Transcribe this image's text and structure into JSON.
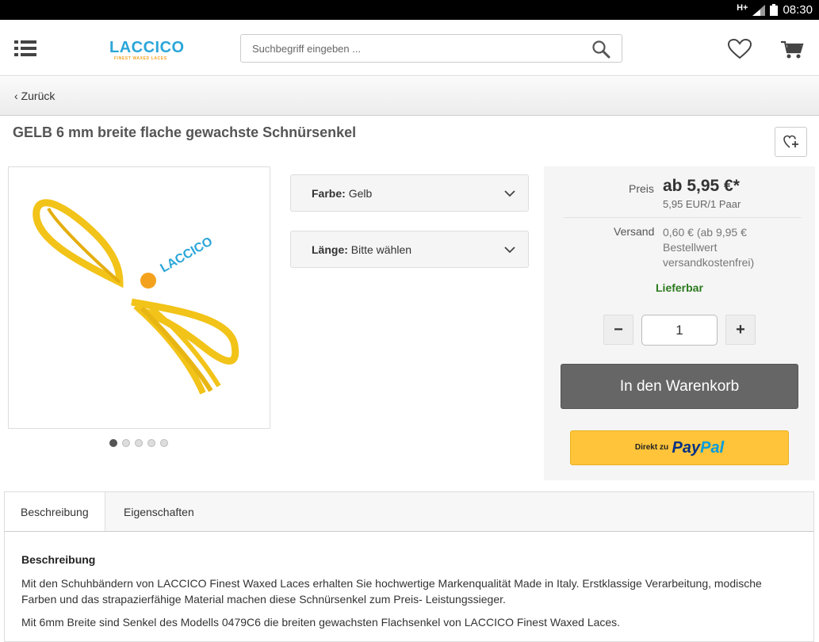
{
  "status_bar": {
    "network": "H+",
    "time": "08:30"
  },
  "header": {
    "logo": {
      "brand": "LACCICO",
      "tagline": "FINEST WAXED LACES"
    },
    "search": {
      "placeholder": "Suchbegriff eingeben ..."
    },
    "icons": [
      "menu-icon",
      "search-icon",
      "heart-icon",
      "cart-icon"
    ]
  },
  "nav": {
    "back_label": "Zurück"
  },
  "product": {
    "title": "GELB 6 mm breite flache gewachste Schnürsenkel",
    "image_dots": 5,
    "active_dot": 1,
    "options": [
      {
        "label": "Farbe:",
        "value": "Gelb"
      },
      {
        "label": "Länge:",
        "value": "Bitte wählen"
      }
    ]
  },
  "buybox": {
    "price_label": "Preis",
    "price_value": "ab 5,95 €*",
    "price_unit": "5,95 EUR/1 Paar",
    "shipping_label": "Versand",
    "shipping_value": "0,60 € (ab 9,95 € Bestellwert versandkostenfrei)",
    "availability": "Lieferbar",
    "quantity": "1",
    "minus": "−",
    "plus": "+",
    "cart_button": "In den Warenkorb",
    "paypal_prefix": "Direkt zu",
    "paypal_brand_1": "Pay",
    "paypal_brand_2": "Pal"
  },
  "tabs": [
    {
      "label": "Beschreibung"
    },
    {
      "label": "Eigenschaften"
    }
  ],
  "description": {
    "heading": "Beschreibung",
    "paragraph_1": "Mit den Schuhbändern von LACCICO Finest Waxed Laces erhalten Sie hochwertige Markenqualität Made in Italy. Erstklassige Verarbeitung, modische Farben und das strapazierfähige Material machen diese Schnürsenkel zum Preis- Leistungssieger.",
    "paragraph_2": "Mit 6mm Breite sind Senkel des Modells 0479C6 die breiten gewachsten Flachsenkel von LACCICO Finest Waxed Laces."
  },
  "colors": {
    "accent_blue": "#2aa6d8",
    "accent_orange": "#f4a21d",
    "available_green": "#2a7a1d",
    "cart_button": "#666666",
    "paypal_yellow": "#ffc439"
  }
}
